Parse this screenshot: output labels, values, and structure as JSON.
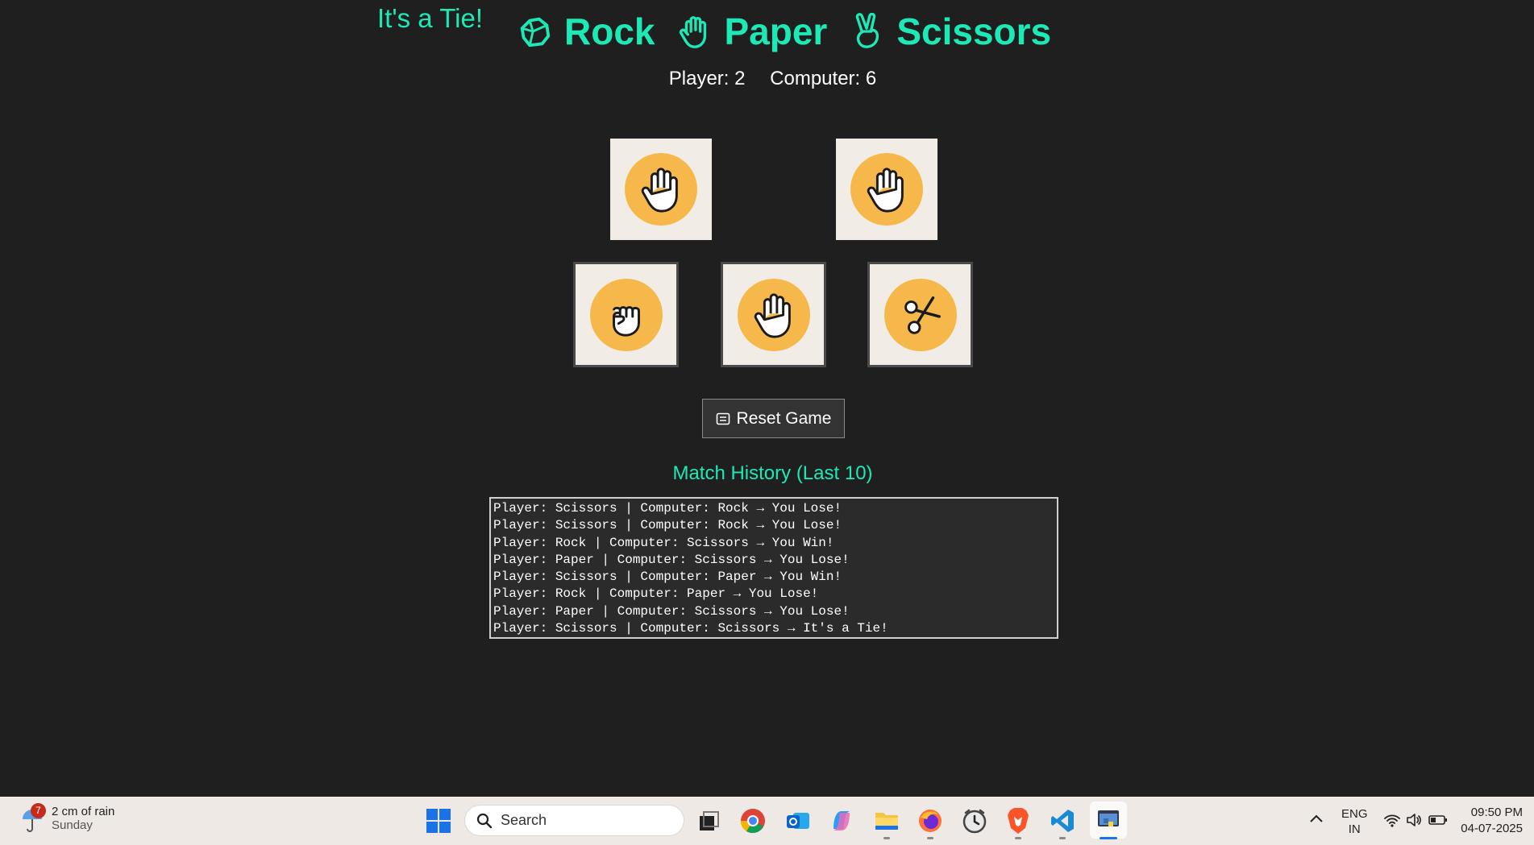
{
  "game": {
    "status": "It's a Tie!",
    "title_words": [
      "Rock",
      "Paper",
      "Scissors"
    ],
    "score": {
      "player": "Player: 2",
      "computer": "Computer: 6"
    },
    "player_choice_icon": "paper-hand-icon",
    "computer_choice_icon": "paper-hand-icon",
    "choices": [
      {
        "name": "rock",
        "icon": "rock-fist-icon"
      },
      {
        "name": "paper",
        "icon": "paper-hand-icon"
      },
      {
        "name": "scissors",
        "icon": "scissors-icon"
      }
    ],
    "reset_label": "Reset Game",
    "history_title": "Match History (Last 10)",
    "history": [
      "Player: Scissors | Computer: Rock → You Lose!",
      "Player: Scissors | Computer: Rock → You Lose!",
      "Player: Rock | Computer: Scissors → You Win!",
      "Player: Paper | Computer: Scissors → You Lose!",
      "Player: Scissors | Computer: Paper → You Win!",
      "Player: Rock | Computer: Paper → You Lose!",
      "Player: Paper | Computer: Scissors → You Lose!",
      "Player: Scissors | Computer: Scissors → It's a Tie!"
    ],
    "colors": {
      "accent": "#1de9b6",
      "background": "#1f1f1f",
      "icon_circle": "#f7b84b",
      "card": "#f1ede6"
    }
  },
  "taskbar": {
    "weather_badge": "7",
    "weather_text": "2 cm of rain",
    "weather_day": "Sunday",
    "search_placeholder": "Search",
    "lang_top": "ENG",
    "lang_bottom": "IN",
    "time": "09:50 PM",
    "date": "04-07-2025"
  }
}
